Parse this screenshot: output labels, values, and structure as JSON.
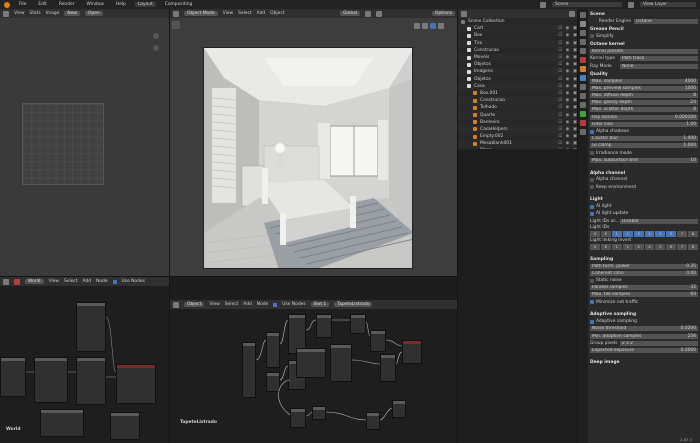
{
  "menubar": {
    "items": [
      "File",
      "Edit",
      "Render",
      "Window",
      "Help"
    ],
    "workspaces": [
      "Layout",
      "Compositing"
    ],
    "scene_label": "Scene",
    "view_layer_label": "View Layer"
  },
  "uv_editor": {
    "menu": [
      "View",
      "Stats",
      "Image"
    ],
    "new_label": "New",
    "open_label": "Open"
  },
  "viewport": {
    "mode": "Object Mode",
    "menu": [
      "View",
      "Select",
      "Add",
      "Object"
    ],
    "transform": "Global",
    "options": "Options"
  },
  "outliner": {
    "root": "Scene Collection",
    "rows": [
      {
        "name": "Cart",
        "indent": 1
      },
      {
        "name": "Box",
        "indent": 1
      },
      {
        "name": "Tiro",
        "indent": 1
      },
      {
        "name": "Construcao",
        "indent": 1
      },
      {
        "name": "Moveis",
        "indent": 1
      },
      {
        "name": "Objetos",
        "indent": 1
      },
      {
        "name": "Imagens",
        "indent": 1
      },
      {
        "name": "Objetos",
        "indent": 1
      },
      {
        "name": "Casa",
        "indent": 1
      },
      {
        "name": "Box.001",
        "indent": 2
      },
      {
        "name": "Construcao",
        "indent": 2
      },
      {
        "name": "Telhado",
        "indent": 2
      },
      {
        "name": "Quarto",
        "indent": 2
      },
      {
        "name": "Banheiro",
        "indent": 2
      },
      {
        "name": "CasaHelpers",
        "indent": 2
      },
      {
        "name": "Empty.002",
        "indent": 2
      },
      {
        "name": "Mesablank001",
        "indent": 2
      },
      {
        "name": "Plano",
        "indent": 2
      },
      {
        "name": "Plano.002",
        "indent": 2
      },
      {
        "name": "Plano.009",
        "indent": 2
      }
    ]
  },
  "properties": {
    "title": "Scene",
    "render_engine_label": "Render Engine",
    "render_engine": "Octane",
    "grease_pencil": "Grease Pencil",
    "simplify": "Simplify",
    "octane_kernel": "Octane kernel",
    "kernel_presets": "Kernel presets",
    "kernel_type_label": "Kernel type",
    "kernel_type": "Path trace",
    "ray_mode_label": "Ray Mode",
    "ray_mode": "None",
    "quality": {
      "title": "Quality",
      "rows": [
        {
          "label": "Max. samples",
          "value": "4000"
        },
        {
          "label": "Max. preview samples",
          "value": "1000"
        },
        {
          "label": "Max. diffuse depth",
          "value": "8"
        },
        {
          "label": "Max. glossy depth",
          "value": "24"
        },
        {
          "label": "Max. scatter depth",
          "value": "8"
        },
        {
          "label": "Ray epsilon",
          "value": "0.000100"
        },
        {
          "label": "Filter size",
          "value": "1.00"
        }
      ],
      "alpha_shadows": "Alpha shadows",
      "rows2": [
        {
          "label": "Caustic blur",
          "value": "1.000"
        },
        {
          "label": "GI clamp",
          "value": "1.000"
        }
      ],
      "irradiance_mode": "Irradiance mode",
      "max_subsurface": {
        "label": "Max. subsurface bnd",
        "value": "10"
      }
    },
    "alpha_channel": {
      "title": "Alpha channel",
      "items": [
        "Alpha channel",
        "Keep environment"
      ]
    },
    "light": {
      "title": "Light",
      "ai_light": "AI light",
      "ai_light_update": "AI light update",
      "light_ids_label": "Light IDs ac...",
      "light_ids_value": "Disable",
      "light_ids_title": "Light IDs",
      "light_ids": [
        "S",
        "E",
        "1",
        "2",
        "3",
        "4",
        "5",
        "6",
        "7",
        "8"
      ],
      "light_linking": "Light linking invert"
    },
    "sampling": {
      "title": "Sampling",
      "rows": [
        {
          "label": "Path term. power",
          "value": "0.35"
        },
        {
          "label": "Coherent ratio",
          "value": "0.00"
        }
      ],
      "static_noise": "Static noise",
      "rows2": [
        {
          "label": "Parallel samples",
          "value": "32"
        },
        {
          "label": "Max. tile samples",
          "value": "64"
        }
      ],
      "minimize_net": "Minimize net traffic"
    },
    "adaptive": {
      "title": "Adaptive sampling",
      "enable": "Adaptive sampling",
      "rows": [
        {
          "label": "Noise threshold",
          "value": "0.0200"
        },
        {
          "label": "Min. adaptive samples",
          "value": "256"
        }
      ],
      "group_pixels": "Group pixels",
      "group_pixels_value": "2 x 2",
      "expected_exposure": {
        "label": "Expected exposure",
        "value": "0.0000"
      }
    },
    "deep_image": "Deep image"
  },
  "world_editor": {
    "world_label": "World",
    "menu": [
      "View",
      "Select",
      "Add",
      "Node"
    ],
    "use_nodes": "Use Nodes",
    "bottom_label": "World"
  },
  "shader_editor": {
    "object_label": "Object",
    "menu": [
      "View",
      "Select",
      "Add",
      "Node"
    ],
    "use_nodes": "Use Nodes",
    "slot": "Slot 1",
    "material": "TapeteListrado",
    "bottom_label": "TapeteListrado"
  },
  "status": {
    "version": "2.83.3"
  }
}
